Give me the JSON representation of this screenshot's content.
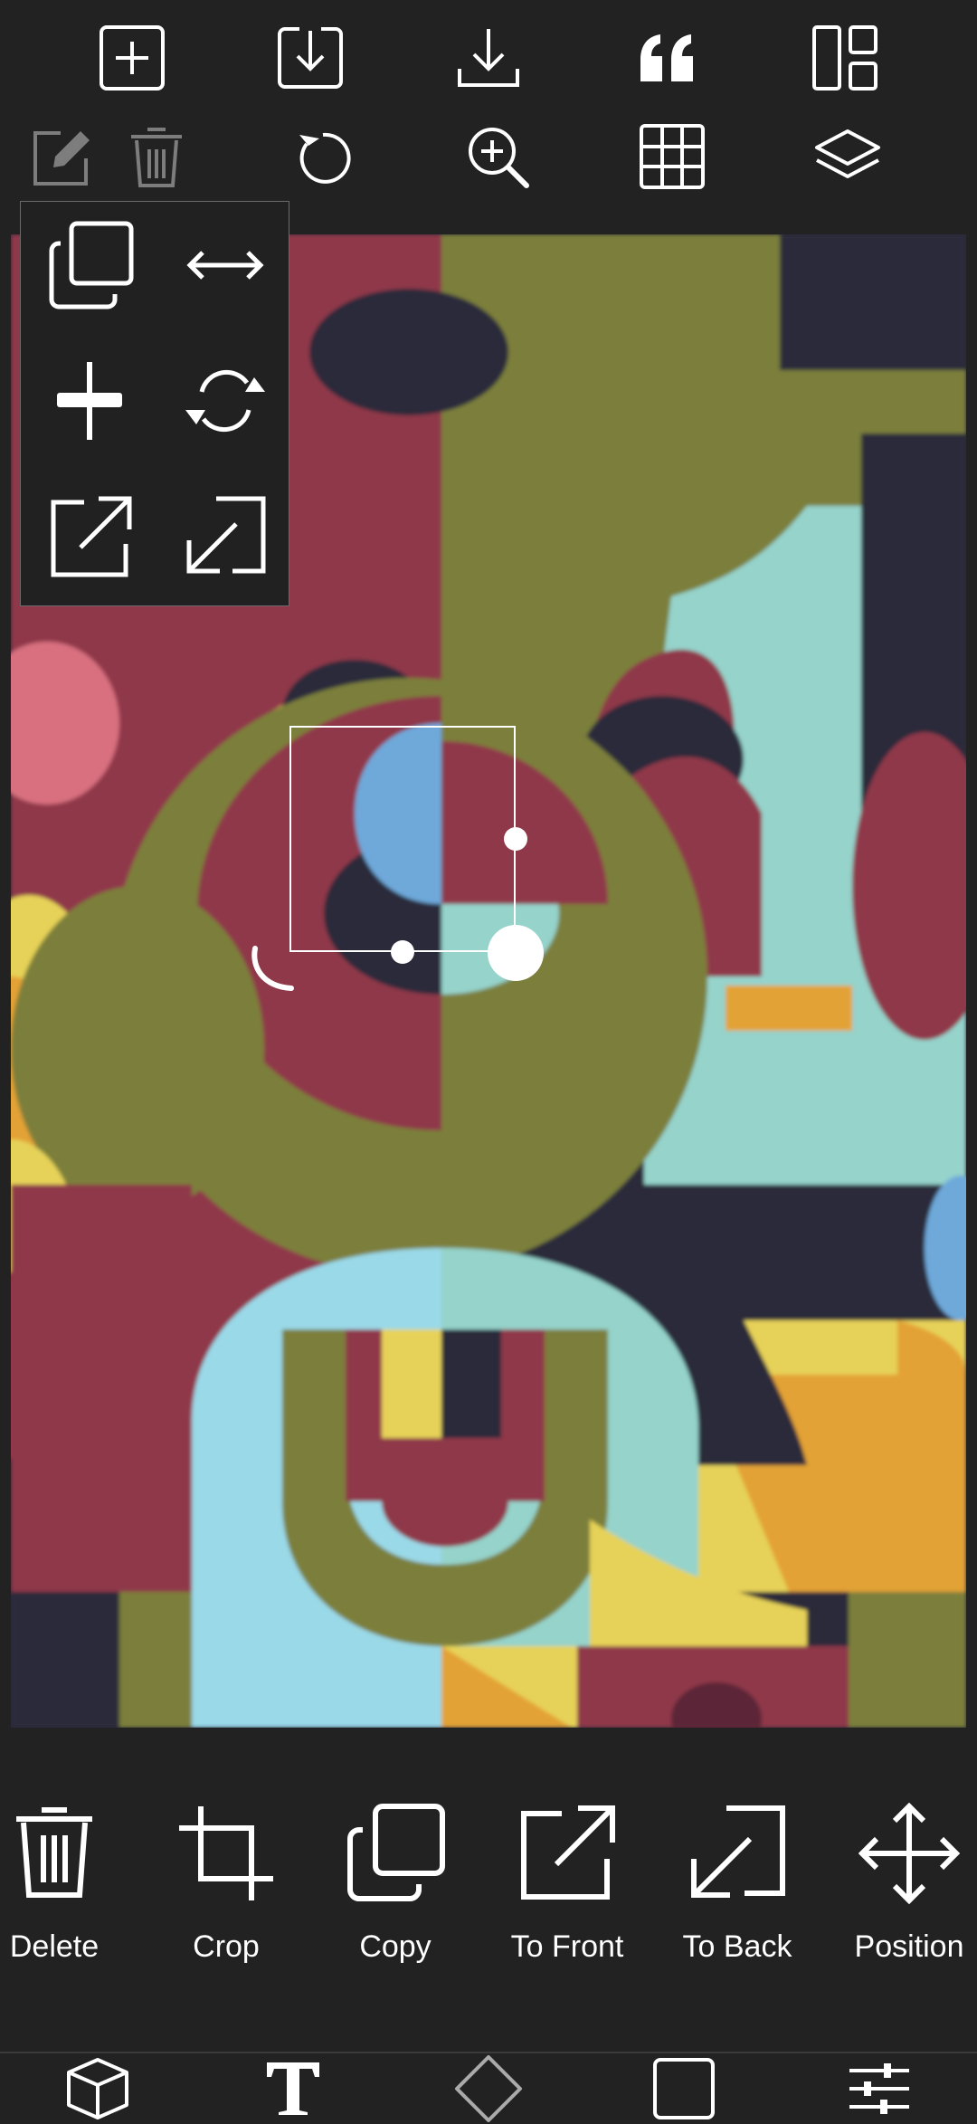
{
  "top_toolbar": {
    "icons": [
      "add-square-icon",
      "import-icon",
      "download-icon",
      "quote-icon",
      "layout-icon"
    ]
  },
  "second_toolbar": {
    "icons": [
      "edit-icon",
      "trash-icon",
      "rotate-icon",
      "zoom-in-icon",
      "grid-icon",
      "layers-icon"
    ]
  },
  "floating_menu": {
    "items": [
      "duplicate-icon",
      "flip-horizontal-icon",
      "plus-icon",
      "rotate-arrows-icon",
      "bring-forward-icon",
      "send-backward-icon"
    ]
  },
  "canvas": {
    "colors": {
      "crimson": "#8f3849",
      "olive": "#7c7f3a",
      "navy": "#2b2a3a",
      "mint": "#95d3cb",
      "sky": "#9ad9e8",
      "yellow": "#e6d258",
      "orange": "#e3a234",
      "pink": "#d8707f",
      "blue": "#6ea9da"
    }
  },
  "action_toolbar": {
    "items": [
      {
        "label": "Delete",
        "icon": "trash-icon"
      },
      {
        "label": "Crop",
        "icon": "crop-icon"
      },
      {
        "label": "Copy",
        "icon": "copy-icon"
      },
      {
        "label": "To Front",
        "icon": "to-front-icon"
      },
      {
        "label": "To Back",
        "icon": "to-back-icon"
      },
      {
        "label": "Position",
        "icon": "move-icon"
      }
    ]
  },
  "bottom_nav": {
    "icons": [
      "cube-icon",
      "text-icon",
      "diamond-icon",
      "square-icon",
      "sliders-icon"
    ]
  }
}
